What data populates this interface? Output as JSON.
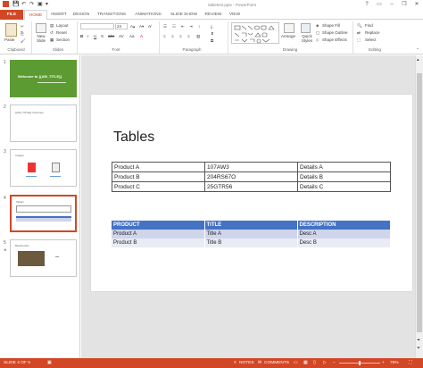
{
  "window": {
    "title": "tabletest.pptx - PowerPoint",
    "help": "?",
    "minimize": "–",
    "restore": "❐",
    "close": "✕"
  },
  "tabs": [
    {
      "label": "FILE"
    },
    {
      "label": "HOME"
    },
    {
      "label": "INSERT"
    },
    {
      "label": "DESIGN"
    },
    {
      "label": "TRANSITIONS"
    },
    {
      "label": "ANIMATIONS"
    },
    {
      "label": "SLIDE SHOW"
    },
    {
      "label": "REVIEW"
    },
    {
      "label": "VIEW"
    }
  ],
  "ribbon": {
    "clipboard": {
      "paste": "Paste",
      "label": "Clipboard"
    },
    "slides": {
      "new_slide": "New Slide",
      "layout": "Layout",
      "reset": "Reset",
      "section": "Section",
      "label": "Slides"
    },
    "font": {
      "size": "24",
      "label": "Font"
    },
    "paragraph": {
      "label": "Paragraph"
    },
    "drawing": {
      "arrange": "Arrange",
      "quick_styles": "Quick Styles",
      "shape_fill": "Shape Fill",
      "shape_outline": "Shape Outline",
      "shape_effects": "Shape Effects",
      "label": "Drawing"
    },
    "editing": {
      "find": "Find",
      "replace": "Replace",
      "select": "Select",
      "label": "Editing"
    }
  },
  "thumbnails": [
    {
      "num": "1",
      "text": "Welcome to {{AM_TITLE}}",
      "bg": "#5b9b32"
    },
    {
      "num": "2",
      "text": "{{AM_TITLE}} Overview"
    },
    {
      "num": "3",
      "text": "Images"
    },
    {
      "num": "4",
      "text": "Tables",
      "selected": true
    },
    {
      "num": "5",
      "text": "Biodiversity"
    }
  ],
  "slide": {
    "title": "Tables",
    "table1": [
      [
        "Product A",
        "107AW3",
        "Details A"
      ],
      [
        "Product B",
        "204RS67O",
        "Details B"
      ],
      [
        "Product C",
        "25GTR56",
        "Details C"
      ]
    ],
    "table2": {
      "headers": [
        "PRODUCT",
        "TITLE",
        "DESCRIPTION"
      ],
      "rows": [
        [
          "Product A",
          "Title A",
          "Desc A"
        ],
        [
          "Product B",
          "Title B",
          "Desc B"
        ]
      ]
    }
  },
  "status": {
    "slide_of": "SLIDE 4 OF 5",
    "notes": "NOTES",
    "comments": "COMMENTS",
    "zoom": "78%"
  },
  "colors": {
    "accent": "#d24726",
    "table_header": "#4472c4"
  }
}
